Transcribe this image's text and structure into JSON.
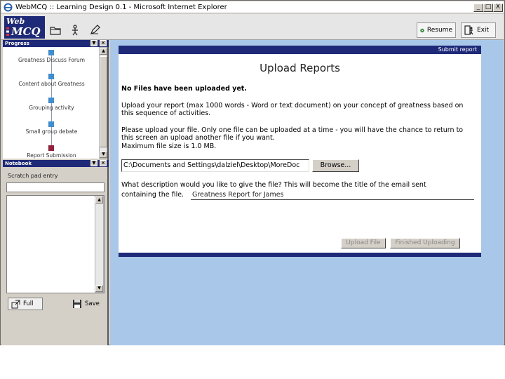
{
  "window": {
    "title": "WebMCQ :: Learning Design 0.1 - Microsoft Internet Explorer",
    "min": "_",
    "max": "□",
    "close": "X"
  },
  "toolbar": {
    "logo_web": "Web",
    "logo_mcq": "MCQ",
    "resume_label": "Resume",
    "exit_label": "Exit"
  },
  "progress": {
    "title": "Progress",
    "steps": [
      {
        "label": "Greatness Discuss Forum",
        "color": "#3a8fd8"
      },
      {
        "label": "Content about Greatness",
        "color": "#3a8fd8"
      },
      {
        "label": "Grouping activity",
        "color": "#3a8fd8"
      },
      {
        "label": "Small group debate",
        "color": "#3a8fd8"
      },
      {
        "label": "Report Submission",
        "color": "#9b1b3a"
      }
    ]
  },
  "notebook": {
    "title": "Notebook",
    "scratch_label": "Scratch pad entry",
    "full_label": "Full",
    "save_label": "Save"
  },
  "main": {
    "header_link": "Submit report",
    "title": "Upload Reports",
    "status": "No Files have been uploaded yet.",
    "instruction1": "Upload your report (max 1000 words - Word or text document) on your concept of greatness based on this sequence of activities.",
    "instruction2": "Please upload your file. Only one file can be uploaded at a time - you will have the chance to return to this screen an upload another file if you want.",
    "instruction3": "Maximum file size is 1.0 MB.",
    "file_path": "C:\\Documents and Settings\\dalziel\\Desktop\\MoreDoc",
    "browse_label": "Browse...",
    "desc_question": "What description would you like to give the file? This will become the title of the email sent",
    "desc_prefix": "containing the file.",
    "desc_value": "Greatness Report for James",
    "upload_label": "Upload File",
    "finished_label": "Finished Uploading"
  }
}
